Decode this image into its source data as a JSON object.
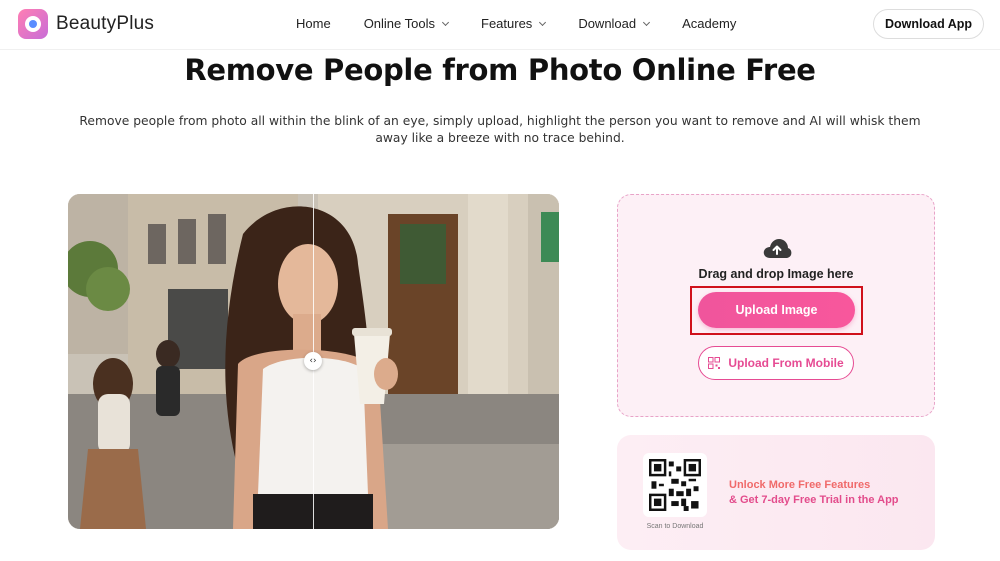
{
  "brand": {
    "name": "BeautyPlus",
    "accent": "#f0559c"
  },
  "nav": {
    "items": [
      {
        "label": "Home",
        "dropdown": false
      },
      {
        "label": "Online Tools",
        "dropdown": true
      },
      {
        "label": "Features",
        "dropdown": true
      },
      {
        "label": "Download",
        "dropdown": true
      },
      {
        "label": "Academy",
        "dropdown": false
      }
    ],
    "cta_label": "Download App"
  },
  "hero": {
    "title": "Remove People from Photo Online Free",
    "subtitle": "Remove people from photo all within the blink of an eye, simply upload, highlight the person you want to remove and AI will whisk them away like a breeze with no trace behind."
  },
  "compare": {
    "handle_glyph": "‹›"
  },
  "upload": {
    "drag_text": "Drag and drop Image here",
    "upload_label": "Upload Image",
    "mobile_label": "Upload From Mobile"
  },
  "promo": {
    "line1": "Unlock More Free Features",
    "line2": "& Get 7-day Free Trial in the App",
    "scan_label": "Scan to Download"
  }
}
